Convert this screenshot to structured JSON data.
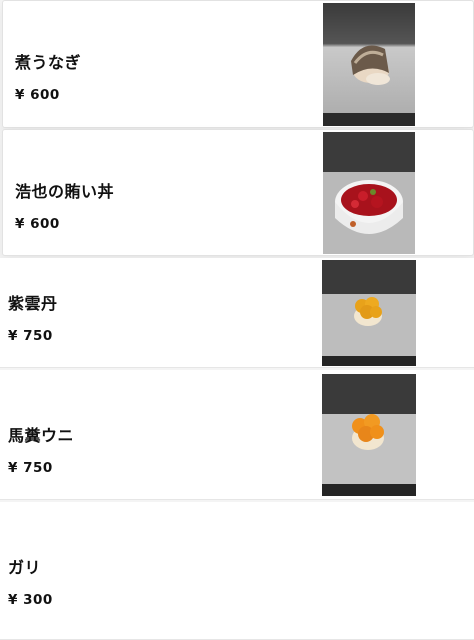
{
  "menu": {
    "items": [
      {
        "name": "煮うなぎ",
        "price": "¥ 600",
        "image": "eel-nigiri-photo"
      },
      {
        "name": "浩也の賄い丼",
        "price": "¥ 600",
        "image": "tuna-bowl-photo"
      },
      {
        "name": "紫雲丹",
        "price": "¥ 750",
        "image": "purple-urchin-nigiri-photo"
      },
      {
        "name": "馬糞ウニ",
        "price": "¥ 750",
        "image": "bafun-urchin-nigiri-photo"
      },
      {
        "name": "ガリ",
        "price": "¥ 300",
        "image": ""
      }
    ]
  },
  "colors": {
    "background": "#f4f4f4",
    "card": "#ffffff",
    "text": "#111111"
  }
}
